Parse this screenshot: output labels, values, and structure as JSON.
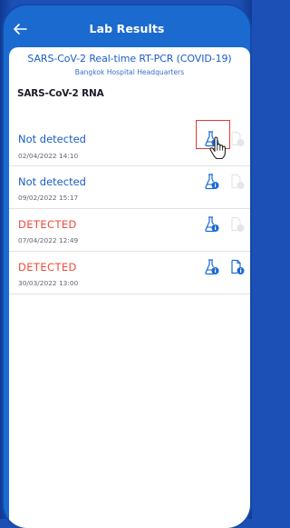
{
  "header": {
    "title": "Lab Results"
  },
  "test": {
    "title": "SARS-CoV-2 Real-time RT-PCR (COVID-19)",
    "hospital": "Bangkok Hospital Headquarters",
    "section": "SARS-CoV-2 RNA"
  },
  "results": [
    {
      "status": "Not detected",
      "date": "02/04/2022 14:10",
      "kind": "negative"
    },
    {
      "status": "Not detected",
      "date": "09/02/2022 15:17",
      "kind": "negative"
    },
    {
      "status": "DETECTED",
      "date": "07/04/2022 12:49",
      "kind": "positive"
    },
    {
      "status": "DETECTED",
      "date": "30/03/2022 13:00",
      "kind": "positive"
    }
  ],
  "colors": {
    "brand": "#1b6ad0",
    "negative_text": "#1a5ec4",
    "positive_text": "#ee4b3a",
    "highlight": "#e53935"
  },
  "icons": [
    "back-arrow-icon",
    "lab-flask-info-icon",
    "document-info-icon",
    "hand-pointer-cursor-icon"
  ]
}
